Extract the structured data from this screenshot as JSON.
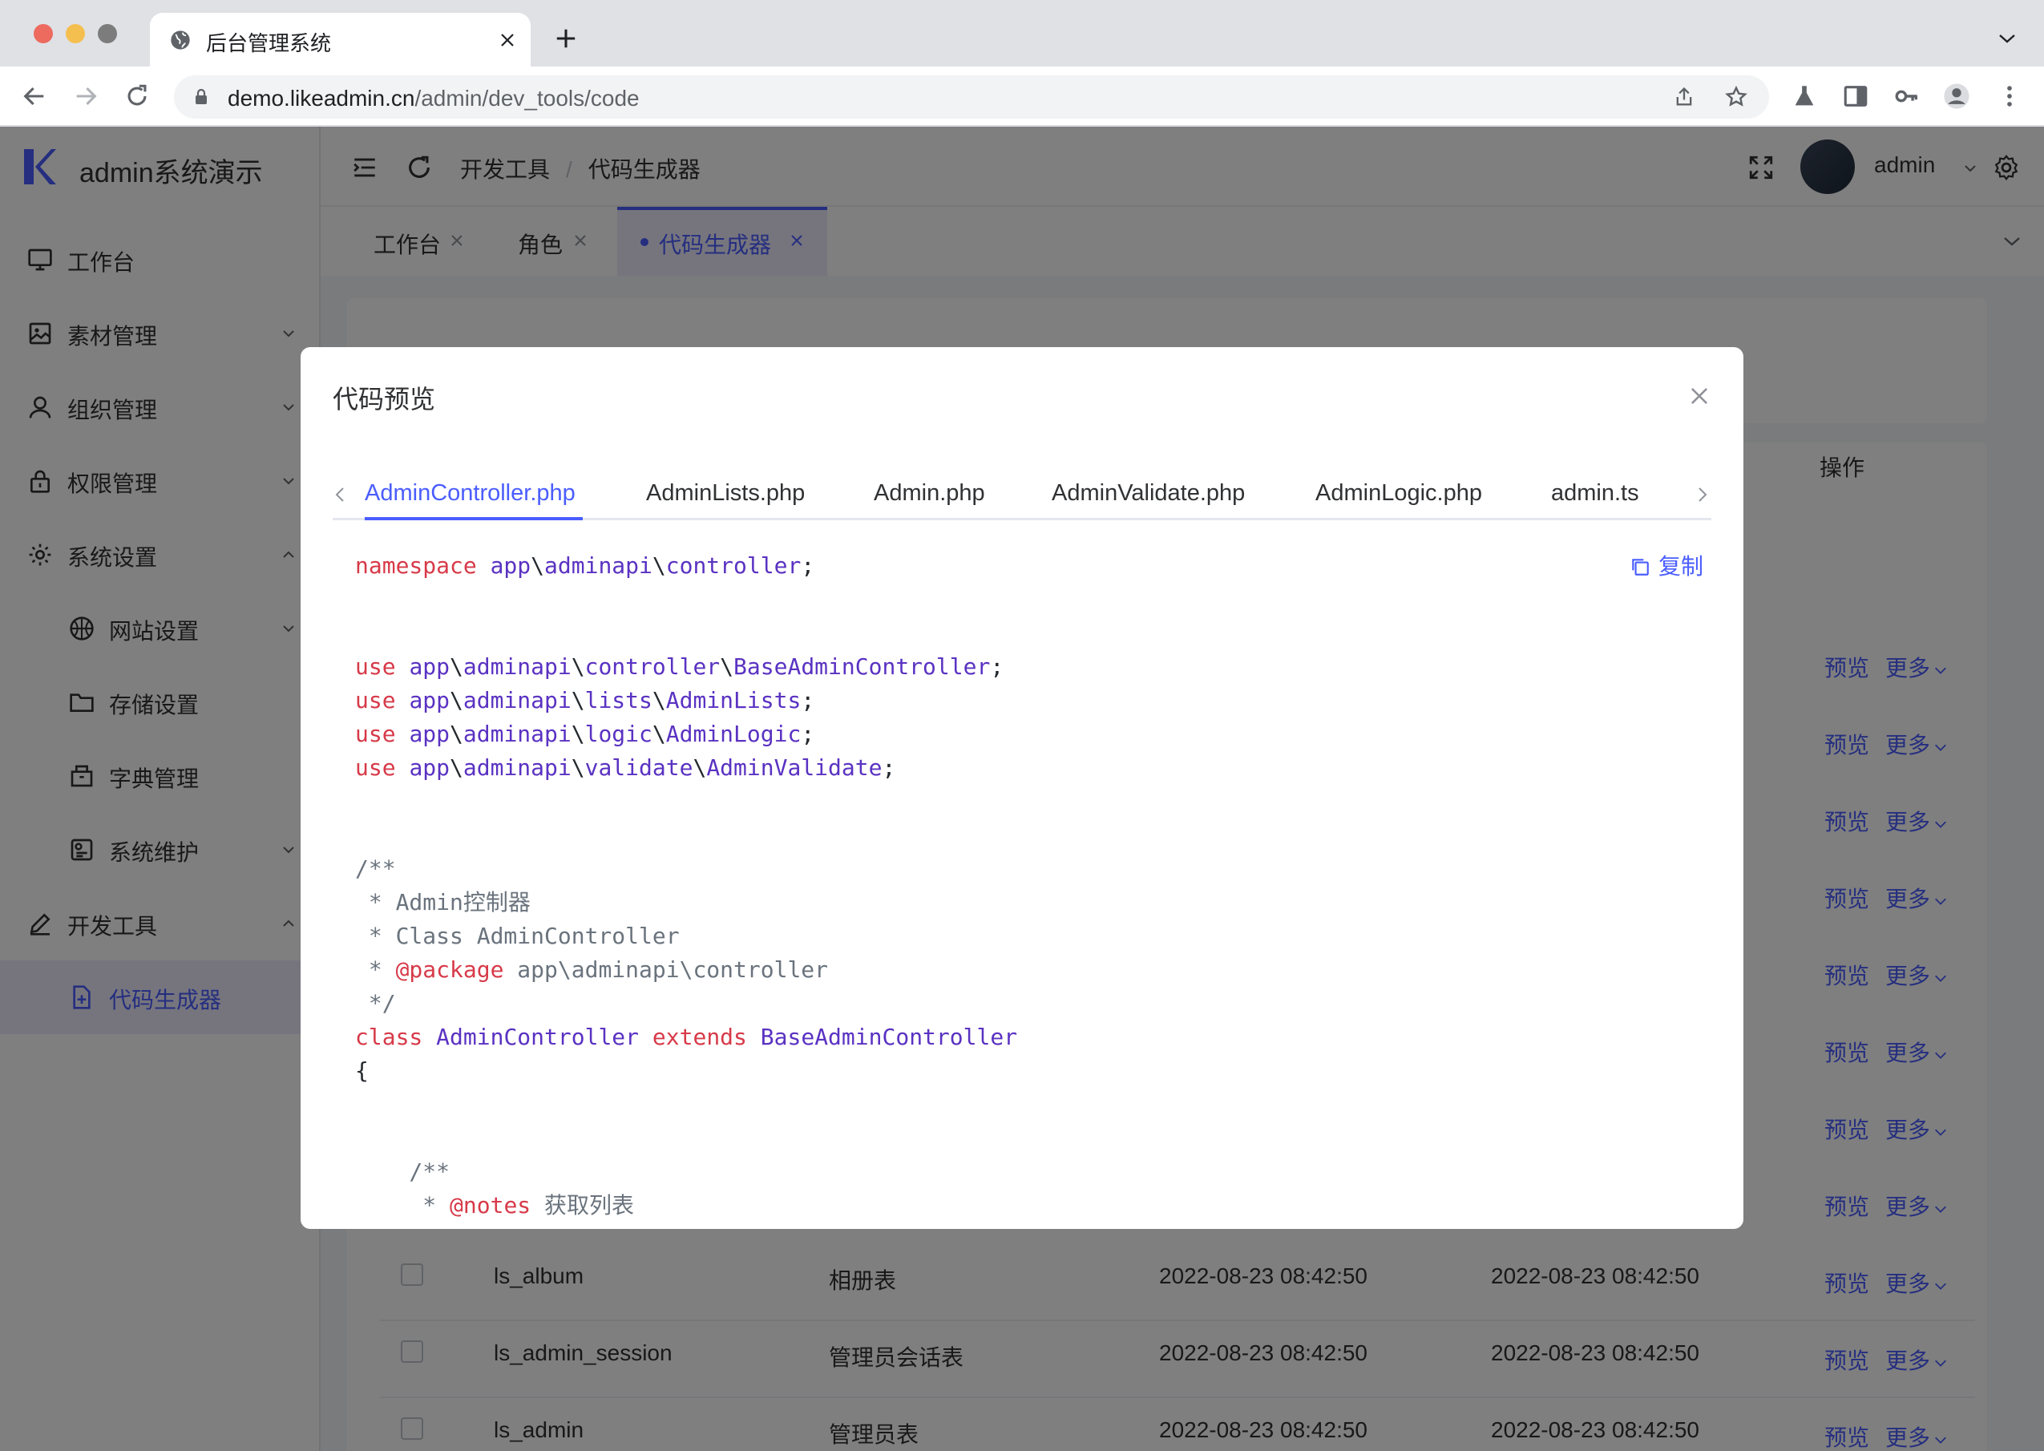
{
  "browser": {
    "tab_title": "后台管理系统",
    "url_host": "demo.likeadmin.cn",
    "url_path": "/admin/dev_tools/code"
  },
  "sidebar": {
    "app_name": "admin系统演示",
    "items": [
      {
        "label": "工作台",
        "icon": "monitor-icon"
      },
      {
        "label": "素材管理",
        "icon": "picture-icon"
      },
      {
        "label": "组织管理",
        "icon": "user-icon"
      },
      {
        "label": "权限管理",
        "icon": "lock-icon"
      },
      {
        "label": "系统设置",
        "icon": "gear-icon"
      },
      {
        "label": "网站设置",
        "icon": "basketball-icon"
      },
      {
        "label": "存储设置",
        "icon": "folder-icon"
      },
      {
        "label": "字典管理",
        "icon": "box-icon"
      },
      {
        "label": "系统维护",
        "icon": "tools-icon"
      },
      {
        "label": "开发工具",
        "icon": "edit-icon"
      },
      {
        "label": "代码生成器",
        "icon": "document-add-icon"
      }
    ]
  },
  "header": {
    "breadcrumb": [
      "开发工具",
      "代码生成器"
    ],
    "username": "admin"
  },
  "page_tabs": [
    {
      "label": "工作台"
    },
    {
      "label": "角色"
    },
    {
      "label": "代码生成器"
    }
  ],
  "table": {
    "ops_header": "操作",
    "preview_label": "预览",
    "more_label": "更多",
    "rows": [
      {
        "name": "ls_album",
        "comment": "相册表",
        "created": "2022-08-23 08:42:50",
        "updated": "2022-08-23 08:42:50"
      },
      {
        "name": "ls_admin_session",
        "comment": "管理员会话表",
        "created": "2022-08-23 08:42:50",
        "updated": "2022-08-23 08:42:50"
      },
      {
        "name": "ls_admin",
        "comment": "管理员表",
        "created": "2022-08-23 08:42:50",
        "updated": "2022-08-23 08:42:50"
      }
    ]
  },
  "dialog": {
    "title": "代码预览",
    "copy_label": "复制",
    "files": [
      "AdminController.php",
      "AdminLists.php",
      "Admin.php",
      "AdminValidate.php",
      "AdminLogic.php",
      "admin.ts"
    ],
    "active_file": "AdminController.php",
    "code_lines": [
      [
        [
          "kw",
          "namespace"
        ],
        [
          "t",
          " "
        ],
        [
          "ns",
          "app"
        ],
        [
          "t",
          "\\"
        ],
        [
          "ns",
          "adminapi"
        ],
        [
          "t",
          "\\"
        ],
        [
          "ns",
          "controller"
        ],
        [
          "t",
          ";"
        ]
      ],
      [],
      [],
      [
        [
          "kw",
          "use"
        ],
        [
          "t",
          " "
        ],
        [
          "ns",
          "app"
        ],
        [
          "t",
          "\\"
        ],
        [
          "ns",
          "adminapi"
        ],
        [
          "t",
          "\\"
        ],
        [
          "ns",
          "controller"
        ],
        [
          "t",
          "\\"
        ],
        [
          "ns",
          "BaseAdminController"
        ],
        [
          "t",
          ";"
        ]
      ],
      [
        [
          "kw",
          "use"
        ],
        [
          "t",
          " "
        ],
        [
          "ns",
          "app"
        ],
        [
          "t",
          "\\"
        ],
        [
          "ns",
          "adminapi"
        ],
        [
          "t",
          "\\"
        ],
        [
          "ns",
          "lists"
        ],
        [
          "t",
          "\\"
        ],
        [
          "ns",
          "AdminLists"
        ],
        [
          "t",
          ";"
        ]
      ],
      [
        [
          "kw",
          "use"
        ],
        [
          "t",
          " "
        ],
        [
          "ns",
          "app"
        ],
        [
          "t",
          "\\"
        ],
        [
          "ns",
          "adminapi"
        ],
        [
          "t",
          "\\"
        ],
        [
          "ns",
          "logic"
        ],
        [
          "t",
          "\\"
        ],
        [
          "ns",
          "AdminLogic"
        ],
        [
          "t",
          ";"
        ]
      ],
      [
        [
          "kw",
          "use"
        ],
        [
          "t",
          " "
        ],
        [
          "ns",
          "app"
        ],
        [
          "t",
          "\\"
        ],
        [
          "ns",
          "adminapi"
        ],
        [
          "t",
          "\\"
        ],
        [
          "ns",
          "validate"
        ],
        [
          "t",
          "\\"
        ],
        [
          "ns",
          "AdminValidate"
        ],
        [
          "t",
          ";"
        ]
      ],
      [],
      [],
      [
        [
          "cm",
          "/**"
        ]
      ],
      [
        [
          "cm",
          " * Admin控制器"
        ]
      ],
      [
        [
          "cm",
          " * Class AdminController"
        ]
      ],
      [
        [
          "cm",
          " * "
        ],
        [
          "kw",
          "@package"
        ],
        [
          "cm",
          " app\\adminapi\\controller"
        ]
      ],
      [
        [
          "cm",
          " */"
        ]
      ],
      [
        [
          "kw",
          "class"
        ],
        [
          "t",
          " "
        ],
        [
          "ns",
          "AdminController"
        ],
        [
          "t",
          " "
        ],
        [
          "kw",
          "extends"
        ],
        [
          "t",
          " "
        ],
        [
          "ns",
          "BaseAdminController"
        ]
      ],
      [
        [
          "t",
          "{"
        ]
      ],
      [],
      [],
      [
        [
          "cm",
          "    /**"
        ]
      ],
      [
        [
          "cm",
          "     * "
        ],
        [
          "kw",
          "@notes"
        ],
        [
          "cm",
          " 获取列表"
        ]
      ]
    ]
  }
}
